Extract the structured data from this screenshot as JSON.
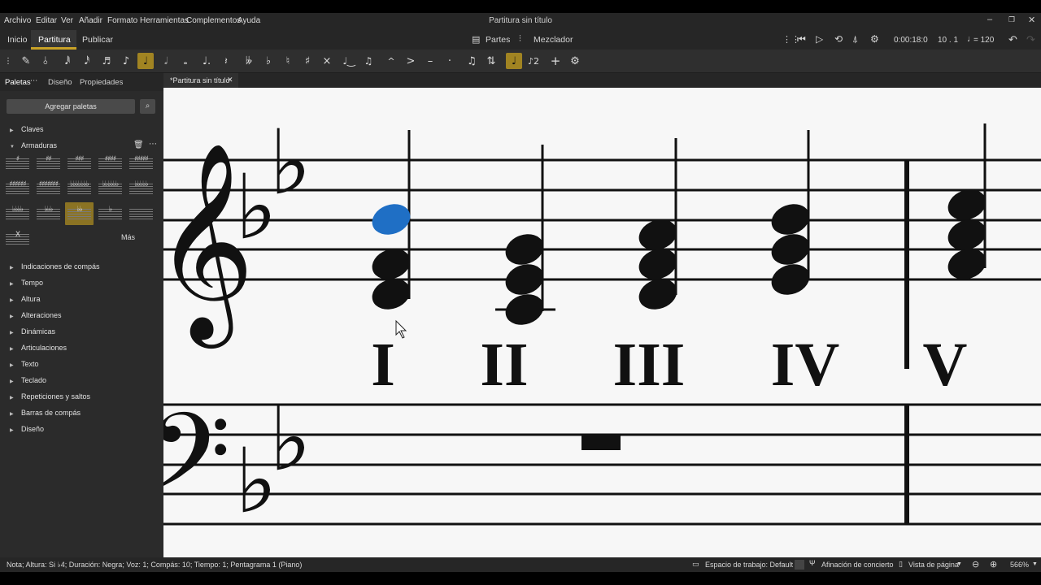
{
  "menu": [
    "Archivo",
    "Editar",
    "Ver",
    "Añadir",
    "Formato",
    "Herramientas",
    "Complementos",
    "Ayuda"
  ],
  "window_title": "Partitura sin título",
  "tabs": {
    "inicio": "Inicio",
    "partitura": "Partitura",
    "publicar": "Publicar"
  },
  "center_tools": {
    "partes": "Partes",
    "mezclador": "Mezclador"
  },
  "playback": {
    "time": "0:00:18:0",
    "position": "10 . 1",
    "tempo": "= 120"
  },
  "side_tabs": {
    "paletas": "Paletas",
    "diseno": "Diseño",
    "propiedades": "Propiedades"
  },
  "palette": {
    "add_label": "Agregar paletas",
    "more_label": "Más",
    "items_top": [
      "Claves",
      "Armaduras"
    ],
    "items_rest": [
      "Indicaciones de compás",
      "Tempo",
      "Altura",
      "Alteraciones",
      "Dinámicas",
      "Articulaciones",
      "Texto",
      "Teclado",
      "Repeticiones y saltos",
      "Barras de compás",
      "Diseño"
    ]
  },
  "doc_tab": "*Partitura sin título",
  "roman_numerals": [
    "I",
    "II",
    "III",
    "IV",
    "V"
  ],
  "status": {
    "note_info": "Nota; Altura: Si ♭4; Duración: Negra; Voz: 1; Compás: 10; Tiempo: 1; Pentagrama 1 (Piano)",
    "workspace": "Espacio de trabajo: Default",
    "concert": "Afinación de concierto",
    "page_view": "Vista de página",
    "zoom": "566%"
  },
  "colors": {
    "accent": "#c9a227",
    "selected_note": "#1f6fc5"
  }
}
